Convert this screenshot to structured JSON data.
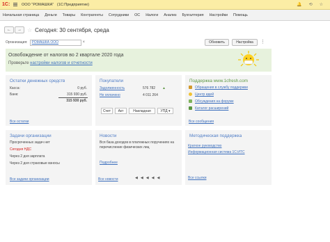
{
  "window": {
    "logo": "1С:",
    "title": "ООО \"РОМАШКА\"",
    "subtitle": "(1С:Предприятие)"
  },
  "sections": [
    "Начальная страница",
    "Деньги",
    "Товары",
    "Контрагенты",
    "Сотрудники",
    "ОС",
    "Налоги",
    "Анализ",
    "Бухгалтерия",
    "Настройки",
    "Помощь"
  ],
  "page": {
    "back_glyph": "←",
    "forward_glyph": "→",
    "title": "Сегодня: 30 сентября, среда"
  },
  "org": {
    "label": "Организация:",
    "value": "РОМАШКА ООО",
    "refresh_label": "Обновить",
    "settings_label": "Настройка"
  },
  "banner": {
    "title": "Освобождение от налогов во 2 квартале 2020 года",
    "text_prefix": "Проверьте ",
    "link": "настройки налогов и отчетности"
  },
  "money": {
    "title": "Остатки денежных средств",
    "rows": [
      {
        "label": "Касса:",
        "value": "0 руб."
      },
      {
        "label": "Банк:",
        "value": "315 930 руб."
      }
    ],
    "total": "315 930 руб.",
    "link": "Все остатки"
  },
  "buyers": {
    "title": "Покупатели",
    "rows": [
      {
        "label": "Задолженность",
        "value": "576 782"
      },
      {
        "label": "Не оплачено",
        "value": "4 011 264"
      }
    ],
    "buttons": [
      "Счет",
      "Акт",
      "Накладная",
      "УПД"
    ]
  },
  "support": {
    "title": "Поддержка www.1cfresh.com",
    "links": [
      "Обращения в службу поддержки",
      "Центр идей",
      "Обсуждения на форуме",
      "Каталог расширений"
    ],
    "all_link": "Все сообщения"
  },
  "tasks": {
    "title": "Задачи организации",
    "rows": [
      "Просроченных задач нет",
      "Сегодня НДС",
      "Через 2 дня зарплата",
      "Через 2 дня страховые взносы"
    ],
    "link": "Все задачи организации"
  },
  "news": {
    "title": "Новости",
    "text": "Вся база доходов в платежных поручениях на перечисление физических лиц",
    "more": "Подробнее",
    "all_link": "Все новости",
    "pager": [
      "◀",
      "◀",
      "◀",
      "◀",
      "◀"
    ]
  },
  "methodic": {
    "title": "Методическая поддержка",
    "links": [
      "Краткое руководство",
      "Информационная система 1С:ИТС"
    ],
    "all_link": "Все ссылки"
  },
  "colors": {
    "accent": "#4d7bc5",
    "brand_red": "#d6201d",
    "banner_bg": "#e7f2dd"
  }
}
